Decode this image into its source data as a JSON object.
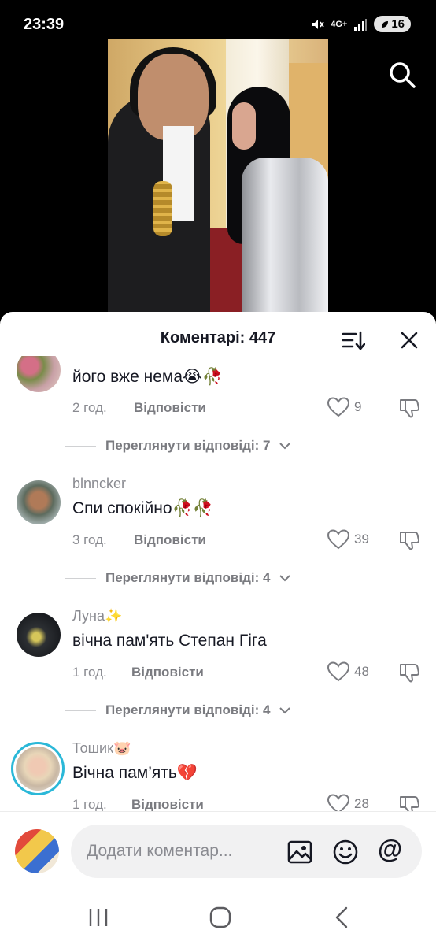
{
  "status_bar": {
    "time": "23:39",
    "network": "4G+",
    "battery": "16"
  },
  "video": {
    "search_icon": "search-icon"
  },
  "comments_sheet": {
    "title": "Коментарі: 447",
    "sort_icon": "sort-icon",
    "close_icon": "close-icon"
  },
  "comments": [
    {
      "username": "",
      "text": "його вже нема😭🥀",
      "time": "2 год.",
      "reply_label": "Відповісти",
      "likes": "9",
      "view_replies": "Переглянути відповіді: 7"
    },
    {
      "username": "blnncker",
      "text": "Спи спокійно🥀🥀",
      "time": "3 год.",
      "reply_label": "Відповісти",
      "likes": "39",
      "view_replies": "Переглянути відповіді: 4"
    },
    {
      "username": "Луна✨",
      "text": "вічна пам'ять Степан Гіга",
      "time": "1 год.",
      "reply_label": "Відповісти",
      "likes": "48",
      "view_replies": "Переглянути відповіді: 4"
    },
    {
      "username": "Тошик🐷",
      "text": "Вічна пам’ять💔",
      "time": "1 год.",
      "reply_label": "Відповісти",
      "likes": "28"
    }
  ],
  "input": {
    "placeholder": "Додати коментар...",
    "at_symbol": "@"
  },
  "colors": {
    "accent_story_ring": "#2bb8d8",
    "text_primary": "#161823",
    "text_secondary": "#8a8b91"
  }
}
